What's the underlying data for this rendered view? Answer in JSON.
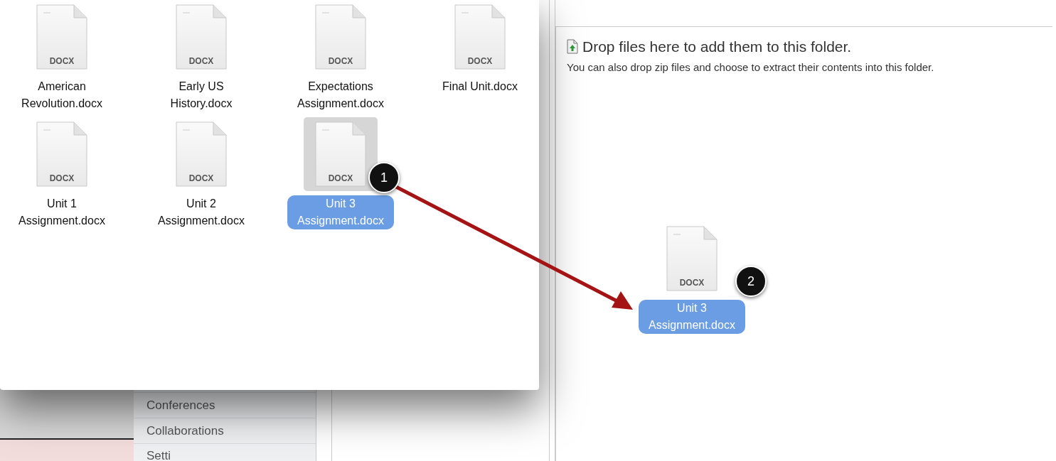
{
  "background_page": {
    "sidebar_items": [
      {
        "label": "Conferences"
      },
      {
        "label": "Collaborations"
      },
      {
        "label": "Setti"
      }
    ]
  },
  "drop_zone": {
    "title": "Drop files here to add them to this folder.",
    "hint": "You can also drop zip files and choose to extract their contents into this folder."
  },
  "finder_window": {
    "files": [
      {
        "name": "American Revolution.docx",
        "type_label": "DOCX",
        "selected": false
      },
      {
        "name": "Early US History.docx",
        "type_label": "DOCX",
        "selected": false
      },
      {
        "name": "Expectations Assignment.docx",
        "type_label": "DOCX",
        "selected": false
      },
      {
        "name": "Final Unit.docx",
        "type_label": "DOCX",
        "selected": false
      },
      {
        "name": "Unit 1 Assignment.docx",
        "type_label": "DOCX",
        "selected": false
      },
      {
        "name": "Unit 2 Assignment.docx",
        "type_label": "DOCX",
        "selected": false
      },
      {
        "name": "Unit 3 Assignment.docx",
        "type_label": "DOCX",
        "selected": true
      }
    ]
  },
  "drag_preview": {
    "name": "Unit 3 Assignment.docx",
    "type_label": "DOCX"
  },
  "callouts": [
    {
      "number": "1"
    },
    {
      "number": "2"
    }
  ]
}
